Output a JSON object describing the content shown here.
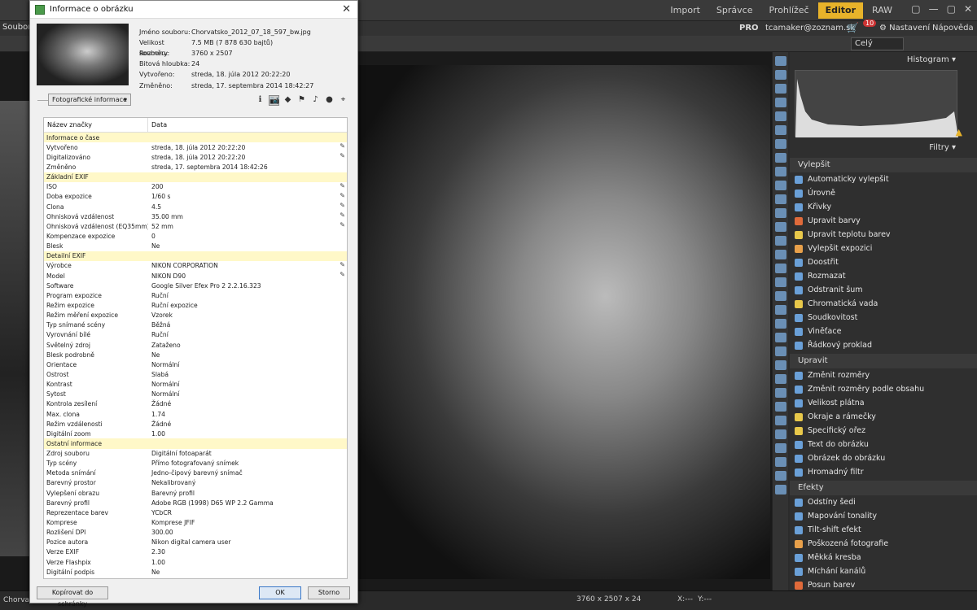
{
  "app": {
    "modes": [
      "Import",
      "Správce",
      "Prohlížeč",
      "Editor",
      "RAW"
    ],
    "active_mode": "Editor",
    "menu_left": "Soubor",
    "pro": "PRO",
    "email": "tcamaker@zoznam.sk",
    "cart_badge": "10",
    "settings": "Nastavení",
    "help": "Nápověda",
    "zoom": "Celý",
    "window_controls": [
      "▢",
      "—",
      "▢",
      "✕"
    ]
  },
  "right_panel": {
    "histogram_label": "Histogram",
    "filter_label": "Filtry",
    "sections": [
      {
        "title": "Vylepšit",
        "items": [
          {
            "label": "Automaticky vylepšit",
            "color": "#6aa0d8"
          },
          {
            "label": "Úrovně",
            "color": "#6aa0d8"
          },
          {
            "label": "Křivky",
            "color": "#6aa0d8"
          },
          {
            "label": "Upravit barvy",
            "color": "#e06a3a"
          },
          {
            "label": "Upravit teplotu barev",
            "color": "#e8c84a"
          },
          {
            "label": "Vylepšit expozici",
            "color": "#e8a04a"
          },
          {
            "label": "Doostřit",
            "color": "#6aa0d8"
          },
          {
            "label": "Rozmazat",
            "color": "#6aa0d8"
          },
          {
            "label": "Odstranit šum",
            "color": "#6aa0d8"
          },
          {
            "label": "Chromatická vada",
            "color": "#e8c84a"
          },
          {
            "label": "Soudkovitost",
            "color": "#6aa0d8"
          },
          {
            "label": "Viněťace",
            "color": "#6aa0d8"
          },
          {
            "label": "Řádkový proklad",
            "color": "#6aa0d8"
          }
        ]
      },
      {
        "title": "Upravit",
        "items": [
          {
            "label": "Změnit rozměry",
            "color": "#6aa0d8"
          },
          {
            "label": "Změnit rozměry podle obsahu",
            "color": "#6aa0d8"
          },
          {
            "label": "Velikost plátna",
            "color": "#6aa0d8"
          },
          {
            "label": "Okraje a rámečky",
            "color": "#e8c84a"
          },
          {
            "label": "Specifický ořez",
            "color": "#e8c84a"
          },
          {
            "label": "Text do obrázku",
            "color": "#6aa0d8"
          },
          {
            "label": "Obrázek do obrázku",
            "color": "#6aa0d8"
          },
          {
            "label": "Hromadný filtr",
            "color": "#6aa0d8"
          }
        ]
      },
      {
        "title": "Efekty",
        "items": [
          {
            "label": "Odstíny šedi",
            "color": "#6aa0d8"
          },
          {
            "label": "Mapování tonality",
            "color": "#6aa0d8"
          },
          {
            "label": "Tilt-shift efekt",
            "color": "#6aa0d8"
          },
          {
            "label": "Poškozená fotografie",
            "color": "#e8a04a"
          },
          {
            "label": "Měkká kresba",
            "color": "#6aa0d8"
          },
          {
            "label": "Míchání kanálů",
            "color": "#6aa0d8"
          },
          {
            "label": "Posun barev",
            "color": "#e06a3a"
          }
        ]
      }
    ]
  },
  "status": {
    "left": "Chorvats",
    "dimensions": "3760 x 2507 x 24",
    "x": "X:---",
    "y": "Y:---"
  },
  "dialog": {
    "title": "Informace o obrázku",
    "props": [
      {
        "k": "Jméno souboru:",
        "v": "Chorvatsko_2012_07_18_597_bw.jpg"
      },
      {
        "k": "Velikost souboru:",
        "v": "7.5 MB (7 878 630 bajtů)"
      },
      {
        "k": "Rozměry:",
        "v": "3760 x 2507"
      },
      {
        "k": "Bitová hloubka:",
        "v": "24"
      },
      {
        "k": "Vytvořeno:",
        "v": "streda, 18. júla 2012 20:22:20"
      },
      {
        "k": "Změněno:",
        "v": "streda, 17. septembra 2014 18:42:27"
      }
    ],
    "dropdown": "Fotografické informace",
    "col1": "Název značky",
    "col2": "Data",
    "rows": [
      {
        "g": true,
        "k": "Informace o čase",
        "v": ""
      },
      {
        "k": "Vytvořeno",
        "v": "streda, 18. júla 2012 20:22:20",
        "e": true
      },
      {
        "k": "Digitalizováno",
        "v": "streda, 18. júla 2012 20:22:20",
        "e": true
      },
      {
        "k": "Změněno",
        "v": "streda, 17. septembra 2014 18:42:26"
      },
      {
        "g": true,
        "k": "Základní EXIF",
        "v": ""
      },
      {
        "k": "ISO",
        "v": "200",
        "e": true
      },
      {
        "k": "Doba expozice",
        "v": "1/60 s",
        "e": true
      },
      {
        "k": "Clona",
        "v": "4.5",
        "e": true
      },
      {
        "k": "Ohnisková vzdálenost",
        "v": "35.00 mm",
        "e": true
      },
      {
        "k": "Ohnisková vzdálenost (EQ35mm)",
        "v": "52 mm",
        "e": true
      },
      {
        "k": "Kompenzace expozice",
        "v": "0"
      },
      {
        "k": "Blesk",
        "v": "Ne"
      },
      {
        "g": true,
        "k": "Detailní EXIF",
        "v": ""
      },
      {
        "k": "Výrobce",
        "v": "NIKON CORPORATION",
        "e": true
      },
      {
        "k": "Model",
        "v": "NIKON D90",
        "e": true
      },
      {
        "k": "Software",
        "v": "Google Silver Efex Pro 2 2.2.16.323"
      },
      {
        "k": "Program expozice",
        "v": "Ruční"
      },
      {
        "k": "Režim expozice",
        "v": "Ruční expozice"
      },
      {
        "k": "Režim měření expozice",
        "v": "Vzorek"
      },
      {
        "k": "Typ snímané scény",
        "v": "Běžná"
      },
      {
        "k": "Vyrovnání bílé",
        "v": "Ruční"
      },
      {
        "k": "Světelný zdroj",
        "v": "Zataženo"
      },
      {
        "k": "Blesk podrobně",
        "v": "Ne"
      },
      {
        "k": "Orientace",
        "v": "Normální"
      },
      {
        "k": "Ostrost",
        "v": "Slabá"
      },
      {
        "k": "Kontrast",
        "v": "Normální"
      },
      {
        "k": "Sytost",
        "v": "Normální"
      },
      {
        "k": "Kontrola zesílení",
        "v": "Žádné"
      },
      {
        "k": "Max. clona",
        "v": "1.74"
      },
      {
        "k": "Režim vzdálenosti",
        "v": "Žádné"
      },
      {
        "k": "Digitální zoom",
        "v": "1.00"
      },
      {
        "g": true,
        "k": "Ostatní informace",
        "v": ""
      },
      {
        "k": "Zdroj souboru",
        "v": "Digitální fotoaparát"
      },
      {
        "k": "Typ scény",
        "v": "Přímo fotografovaný snímek"
      },
      {
        "k": "Metoda snímání",
        "v": "Jedno-čipový barevný snímač"
      },
      {
        "k": "Barevný prostor",
        "v": "Nekalibrovaný"
      },
      {
        "k": "Vylepšení obrazu",
        "v": "Barevný profil"
      },
      {
        "k": "Barevný profil",
        "v": "Adobe RGB (1998) D65 WP 2.2 Gamma"
      },
      {
        "k": "Reprezentace barev",
        "v": "YCbCR"
      },
      {
        "k": "Komprese",
        "v": "Komprese JFIF"
      },
      {
        "k": "Rozlišení DPI",
        "v": "300.00"
      },
      {
        "k": "Pozice autora",
        "v": "Nikon digital camera user"
      },
      {
        "k": "Verze EXIF",
        "v": "2.30"
      },
      {
        "k": "Verze Flashpix",
        "v": "1.00"
      },
      {
        "k": "Digitální podpis",
        "v": "Ne"
      }
    ],
    "copy_button": "Kopírovat do schránky",
    "ok_button": "OK",
    "cancel_button": "Storno"
  }
}
